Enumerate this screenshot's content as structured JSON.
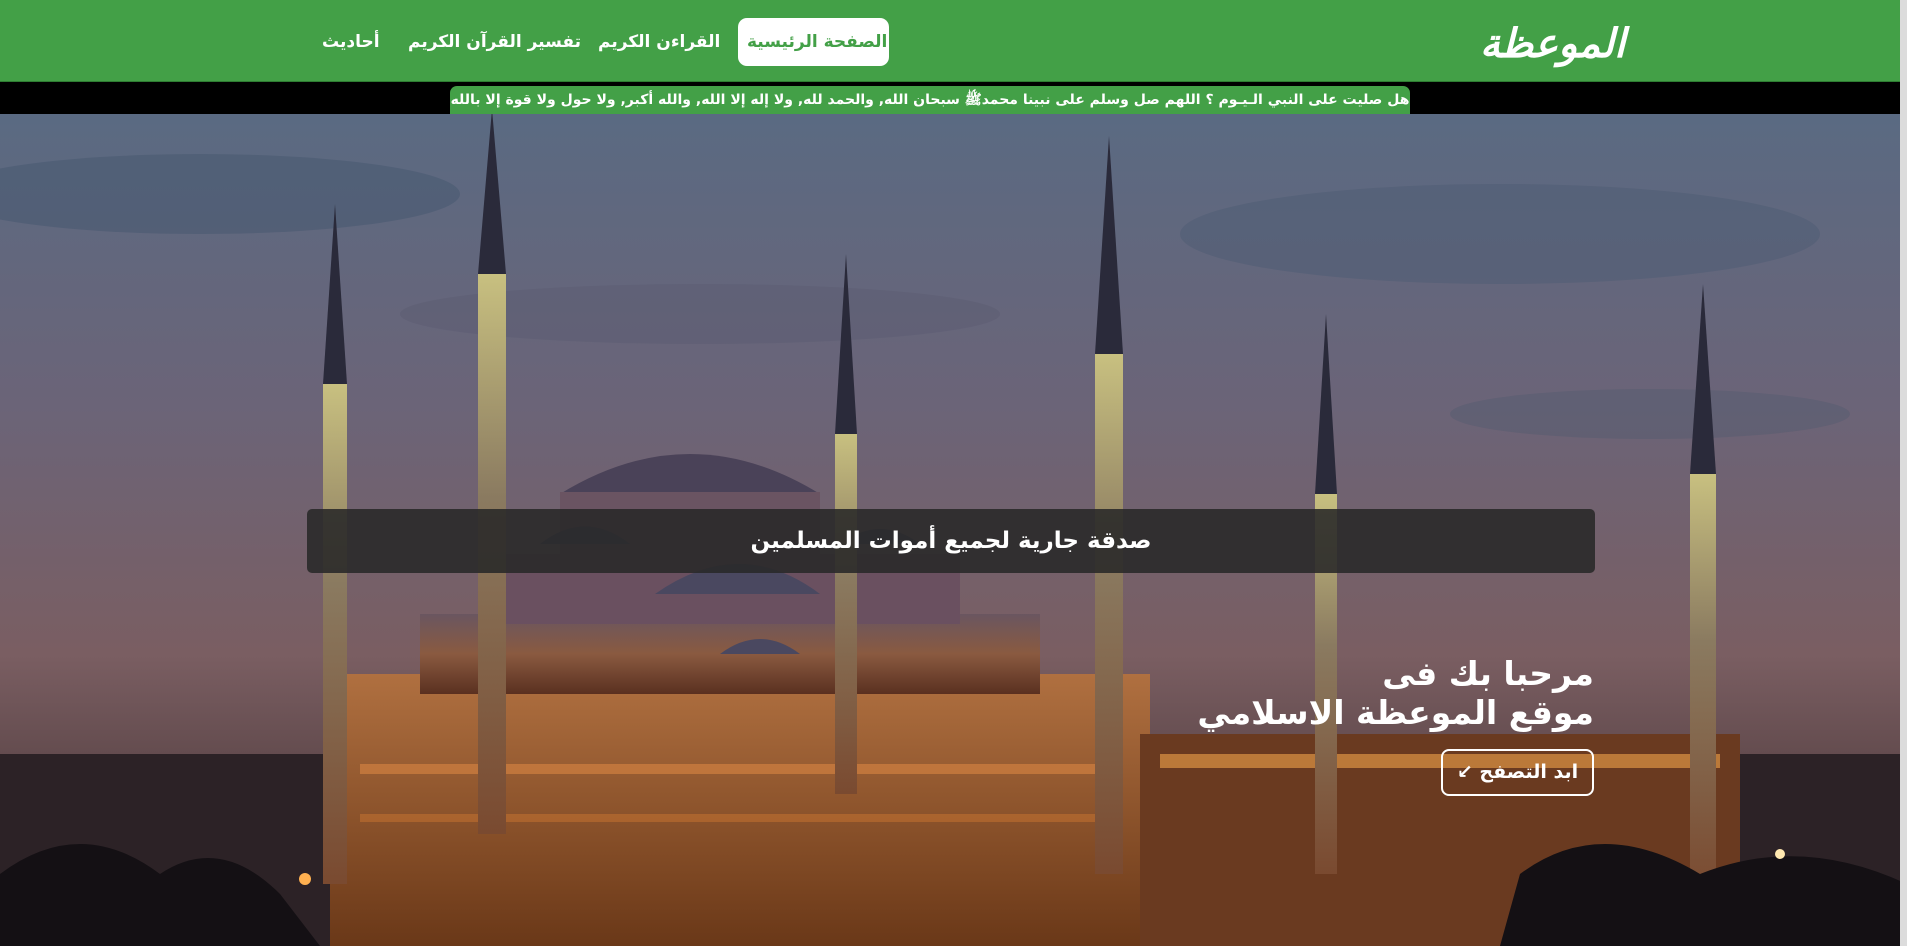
{
  "navbar": {
    "logo_text": "الموعظة",
    "items": [
      {
        "label": "الصفحة الرئيسية",
        "active": true
      },
      {
        "label": "القراءن الكريم",
        "active": false
      },
      {
        "label": "تفسير القرآن الكريم",
        "active": false
      },
      {
        "label": "أحاديث",
        "active": false
      }
    ]
  },
  "ticker": {
    "text": "هل صليت على النبي الـيـوم ؟ اللهم صل وسلم على نبينا محمدﷺ سبحان الله, والحمد لله, ولا إله إلا الله, والله أكبر, ولا حول ولا قوة إلا بالله"
  },
  "hero": {
    "banner_text": "صدقة جارية لجميع أموات المسلمين",
    "welcome_line1": "مرحبا بك فى",
    "welcome_line2": "موقع الموعظة الاسلامي",
    "browse_label": "ابد التصفح",
    "browse_icon": "arrow-down-left-icon"
  },
  "colors": {
    "primary_green": "#43a047",
    "ticker_background": "#000000",
    "banner_background": "#282828"
  }
}
